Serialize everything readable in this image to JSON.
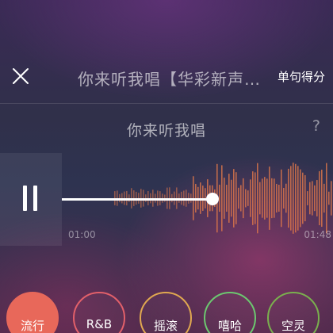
{
  "header": {
    "close_icon": "close-icon",
    "title": "你来听我唱【华彩新声…",
    "score_label": "单句得分"
  },
  "lyric": {
    "text": "你来听我唱",
    "help_label": "?"
  },
  "player": {
    "state": "playing",
    "pause_icon": "pause-icon",
    "progress": 0.55,
    "time_start": "01:00",
    "time_end": "01:48",
    "waveform_color": "#e0784a"
  },
  "genres": [
    {
      "label": "流行",
      "color": "#e8685a",
      "filled": true
    },
    {
      "label": "R&B",
      "color": "#e2606a",
      "filled": false
    },
    {
      "label": "摇滚",
      "color": "#e0a850",
      "filled": false
    },
    {
      "label": "嘻哈",
      "color": "#6cc870",
      "filled": false
    },
    {
      "label": "空灵",
      "color": "#7ab04e",
      "filled": false
    }
  ]
}
